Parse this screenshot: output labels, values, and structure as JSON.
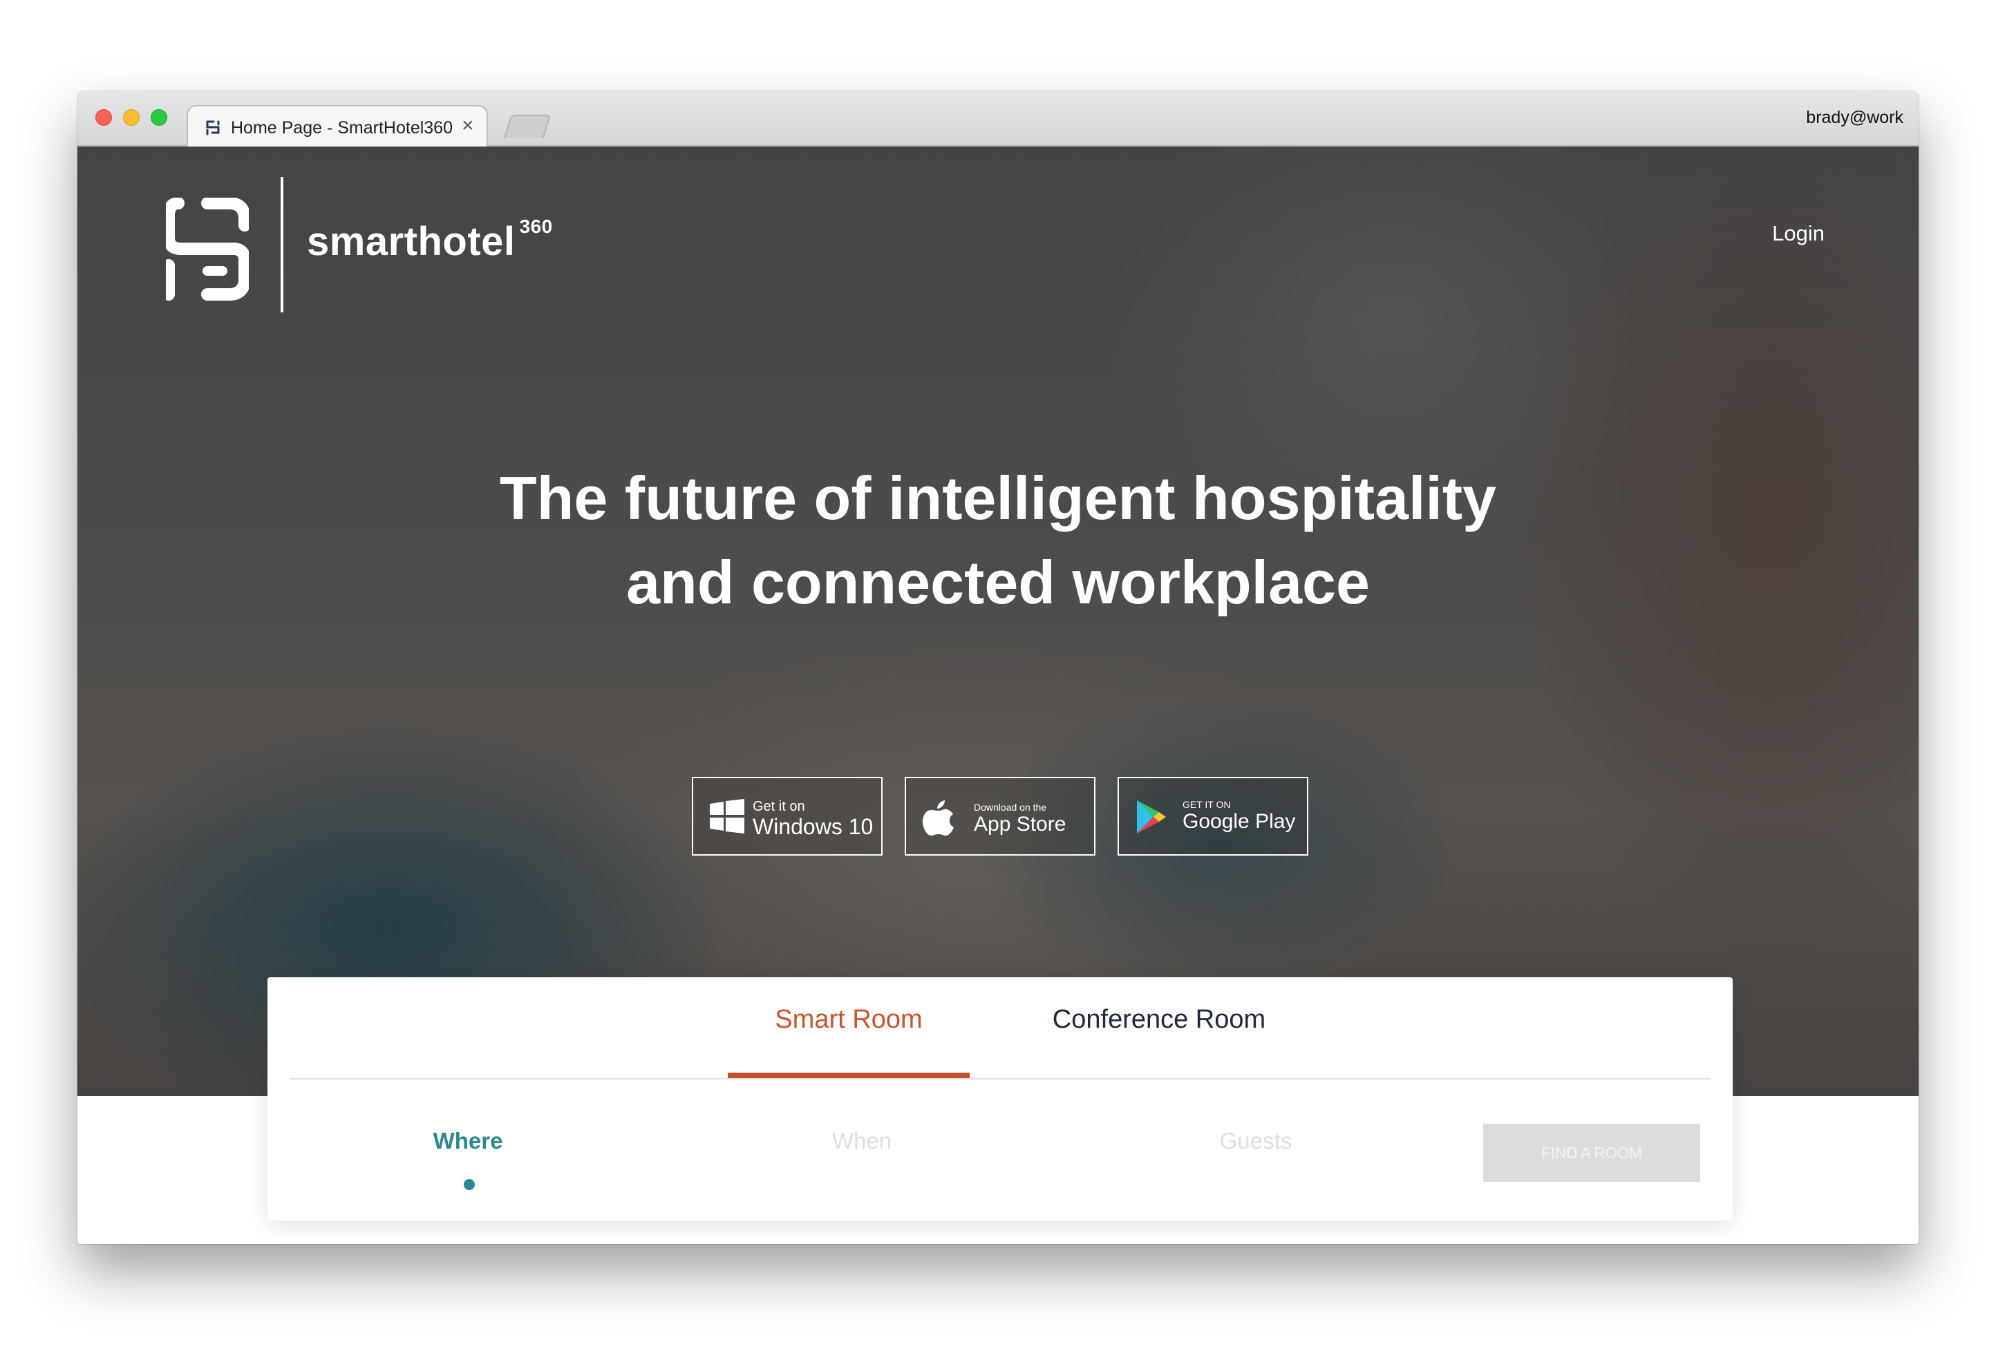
{
  "browser": {
    "tab_title": "Home Page - SmartHotel360",
    "tab_close": "×",
    "profile": "brady@work"
  },
  "header": {
    "brand": "smarthotel",
    "brand_sup": "360",
    "login": "Login"
  },
  "hero": {
    "headline_line1": "The future of intelligent hospitality",
    "headline_line2": "and connected workplace"
  },
  "stores": [
    {
      "small": "Get it on",
      "big": "Windows 10",
      "icon": "windows-icon"
    },
    {
      "small": "Download on the",
      "big": "App Store",
      "icon": "apple-icon"
    },
    {
      "small": "GET IT ON",
      "big": "Google Play",
      "icon": "google-play-icon"
    }
  ],
  "booking": {
    "tabs": [
      "Smart Room",
      "Conference Room"
    ],
    "active_tab": "Smart Room",
    "steps": [
      "Where",
      "When",
      "Guests"
    ],
    "active_step": "Where",
    "find_button": "FIND A ROOM"
  },
  "colors": {
    "accent": "#c5502a",
    "teal": "#2b8a8e",
    "dark_text": "#21283b"
  }
}
